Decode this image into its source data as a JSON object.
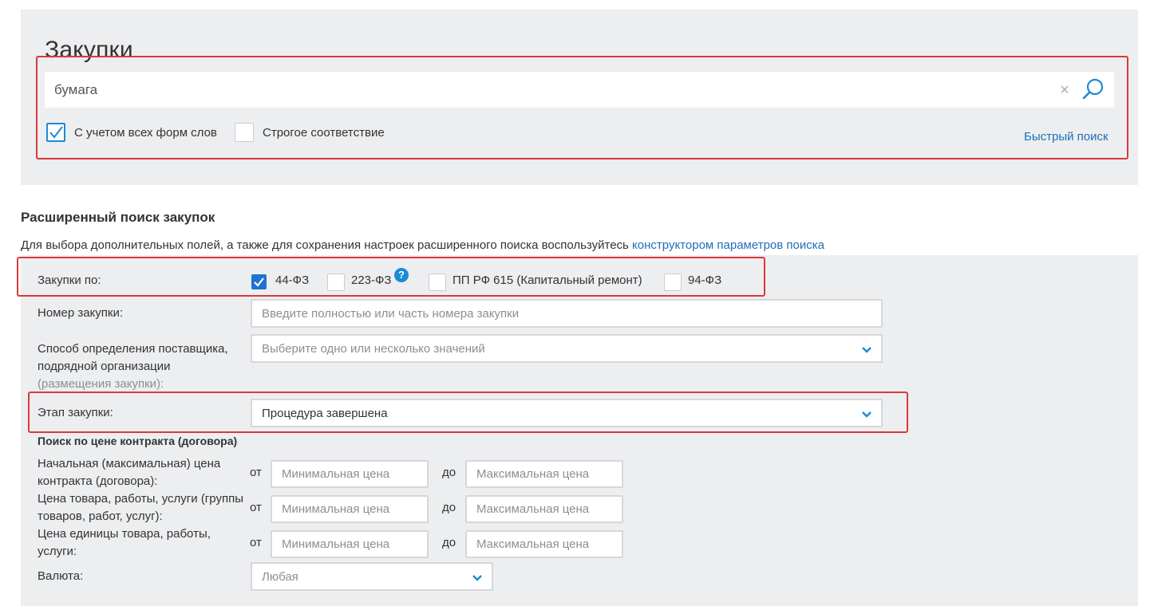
{
  "search": {
    "title": "Закупки",
    "value": "бумага",
    "options": [
      {
        "label": "С учетом всех форм слов",
        "checked": true
      },
      {
        "label": "Строгое соответствие",
        "checked": false
      }
    ],
    "quick_search_label": "Быстрый поиск"
  },
  "advanced": {
    "title": "Расширенный поиск закупок",
    "description": "Для выбора дополнительных полей, а также для сохранения настроек расширенного поиска воспользуйтесь",
    "description_link": "конструктором параметров поиска",
    "purchases_by": {
      "label": "Закупки по:",
      "options": [
        {
          "label": "44-ФЗ",
          "checked": true
        },
        {
          "label": "223-ФЗ",
          "checked": false,
          "help": "?"
        },
        {
          "label": "ПП РФ 615 (Капитальный ремонт)",
          "checked": false
        },
        {
          "label": "94-ФЗ",
          "checked": false
        }
      ]
    },
    "purchase_number": {
      "label": "Номер закупки:",
      "placeholder": "Введите полностью или часть номера закупки"
    },
    "supplier_method": {
      "label_line1": "Способ определения поставщика,",
      "label_line2": "подрядной организации",
      "label_line3": "(размещения закупки):",
      "placeholder": "Выберите одно или несколько значений"
    },
    "stage": {
      "label": "Этап закупки:",
      "value": "Процедура завершена"
    },
    "price_section_title": "Поиск по цене контракта (договора)",
    "price_rows": [
      {
        "label_line1": "Начальная (максимальная) цена",
        "label_line2": "контракта (договора):",
        "from": "от",
        "to": "до",
        "min_placeholder": "Минимальная цена",
        "max_placeholder": "Максимальная цена"
      },
      {
        "label_line1": "Цена товара, работы, услуги (группы",
        "label_line2": "товаров, работ, услуг):",
        "from": "от",
        "to": "до",
        "min_placeholder": "Минимальная цена",
        "max_placeholder": "Максимальная цена"
      },
      {
        "label_line1": "Цена единицы товара, работы,",
        "label_line2": "услуги:",
        "from": "от",
        "to": "до",
        "min_placeholder": "Минимальная цена",
        "max_placeholder": "Максимальная цена"
      }
    ],
    "currency": {
      "label": "Валюта:",
      "value": "Любая"
    }
  },
  "colors": {
    "accent": "#1a8bd6",
    "link": "#1e6fb8",
    "highlight": "#d9393a",
    "panel": "#edeef0"
  }
}
